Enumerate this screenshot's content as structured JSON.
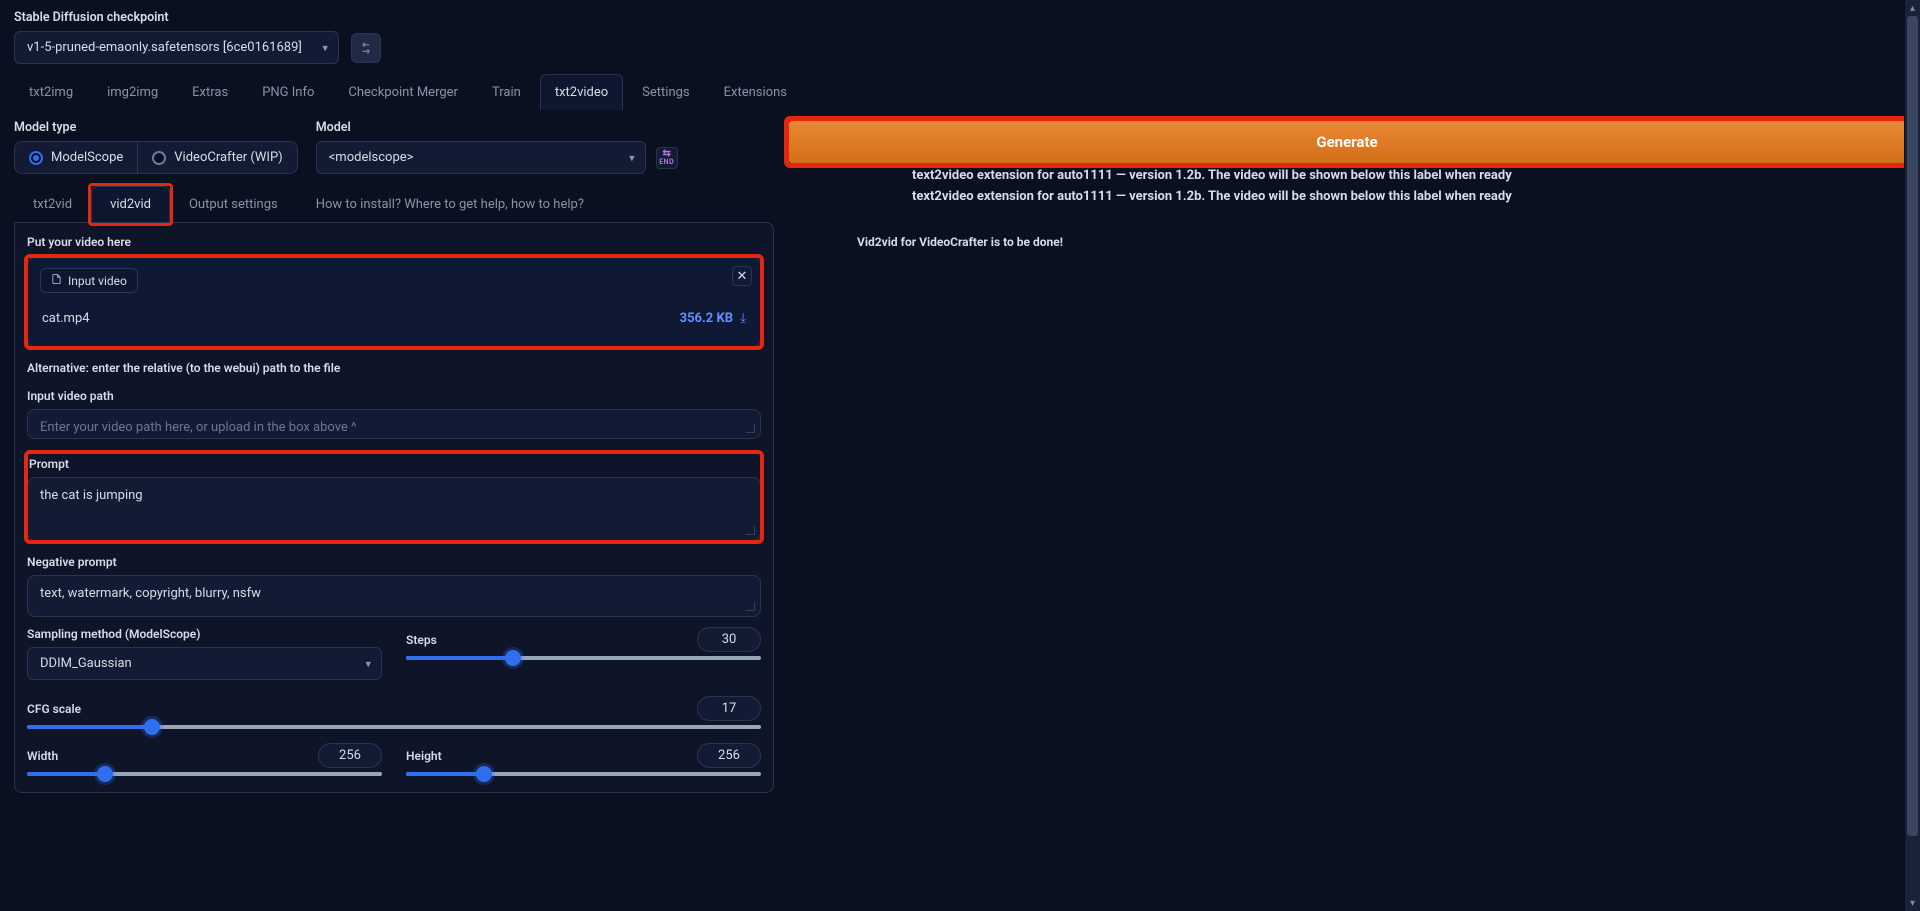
{
  "checkpoint": {
    "label": "Stable Diffusion checkpoint",
    "value": "v1-5-pruned-emaonly.safetensors [6ce0161689]"
  },
  "main_tabs": [
    "txt2img",
    "img2img",
    "Extras",
    "PNG Info",
    "Checkpoint Merger",
    "Train",
    "txt2video",
    "Settings",
    "Extensions"
  ],
  "main_tab_active_index": 6,
  "model_type": {
    "label": "Model type",
    "options": [
      "ModelScope",
      "VideoCrafter (WIP)"
    ],
    "selected_index": 0
  },
  "model": {
    "label": "Model",
    "value": "<modelscope>"
  },
  "sub_tabs": [
    "txt2vid",
    "vid2vid",
    "Output settings",
    "How to install? Where to get help, how to help?"
  ],
  "sub_tab_active_index": 1,
  "panel": {
    "put_label": "Put your video here",
    "note": "Vid2vid for VideoCrafter is to be done!",
    "input_video_tag": "Input video",
    "file_name": "cat.mp4",
    "file_size": "356.2 KB",
    "alt_label": "Alternative: enter the relative (to the webui) path to the file",
    "path_label": "Input video path",
    "path_placeholder": "Enter your video path here, or upload in the box above ^",
    "prompt_label": "Prompt",
    "prompt_value": "the cat is jumping",
    "neg_label": "Negative prompt",
    "neg_value": "text, watermark, copyright, blurry, nsfw",
    "sampling_label": "Sampling method (ModelScope)",
    "sampling_value": "DDIM_Gaussian",
    "steps_label": "Steps",
    "steps_value": "30",
    "steps_fill_pct": 30,
    "cfg_label": "CFG scale",
    "cfg_value": "17",
    "cfg_fill_pct": 17,
    "width_label": "Width",
    "width_value": "256",
    "height_label": "Height",
    "height_value": "256"
  },
  "right": {
    "generate_label": "Generate",
    "msg": "text2video extension for auto1111 — version 1.2b. The video will be shown below this label when ready"
  }
}
